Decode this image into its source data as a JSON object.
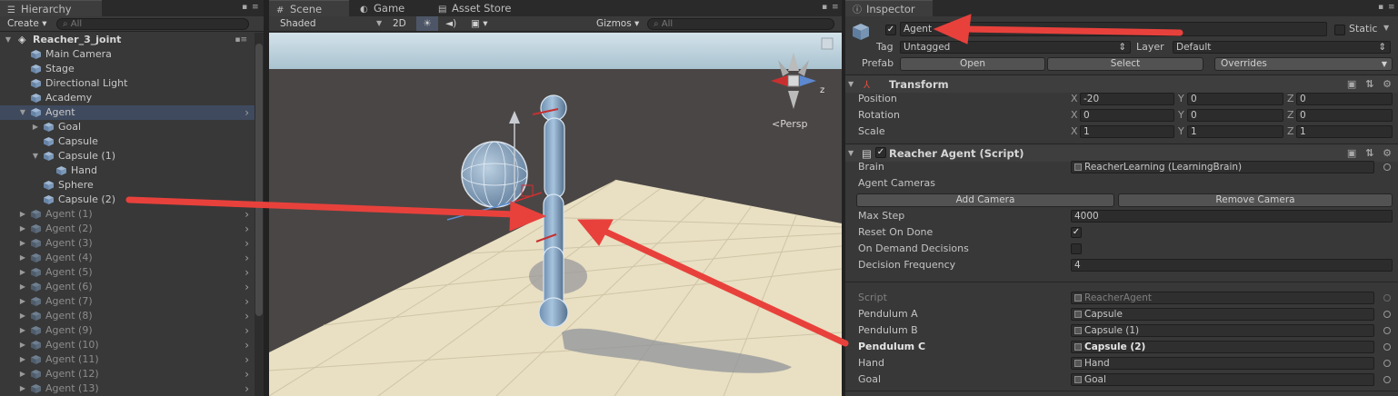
{
  "hierarchy": {
    "tab_label": "Hierarchy",
    "create_label": "Create ▾",
    "search_placeholder": "All",
    "scene_name": "Reacher_3_joint",
    "items": [
      "Main Camera",
      "Stage",
      "Directional Light",
      "Academy",
      "Agent",
      "Goal",
      "Capsule",
      "Capsule (1)",
      "Hand",
      "Sphere",
      "Capsule (2)",
      "Agent (1)",
      "Agent (2)",
      "Agent (3)",
      "Agent (4)",
      "Agent (5)",
      "Agent (6)",
      "Agent (7)",
      "Agent (8)",
      "Agent (9)",
      "Agent (10)",
      "Agent (11)",
      "Agent (12)",
      "Agent (13)"
    ]
  },
  "scene": {
    "tabs": [
      "Scene",
      "Game",
      "Asset Store"
    ],
    "shading_mode": "Shaded",
    "mode_2d": "2D",
    "gizmos_label": "Gizmos",
    "search_placeholder": "All",
    "projection_label": "Persp",
    "gizmo_axis_z": "z"
  },
  "inspector": {
    "tab_label": "Inspector",
    "object_name": "Agent",
    "static_label": "Static",
    "tag_label": "Tag",
    "tag_value": "Untagged",
    "layer_label": "Layer",
    "layer_value": "Default",
    "prefab_label": "Prefab",
    "open_label": "Open",
    "select_label": "Select",
    "overrides_label": "Overrides",
    "transform": {
      "title": "Transform",
      "rows": [
        {
          "label": "Position",
          "x": "-20",
          "y": "0",
          "z": "0"
        },
        {
          "label": "Rotation",
          "x": "0",
          "y": "0",
          "z": "0"
        },
        {
          "label": "Scale",
          "x": "1",
          "y": "1",
          "z": "1"
        }
      ]
    },
    "script": {
      "title": "Reacher Agent (Script)",
      "brain_label": "Brain",
      "brain_value": "ReacherLearning (LearningBrain)",
      "agent_cameras_label": "Agent Cameras",
      "add_camera": "Add Camera",
      "remove_camera": "Remove Camera",
      "max_step_label": "Max Step",
      "max_step_value": "4000",
      "reset_on_done_label": "Reset On Done",
      "on_demand_label": "On Demand Decisions",
      "decision_freq_label": "Decision Frequency",
      "decision_freq_value": "4",
      "script_label": "Script",
      "script_value": "ReacherAgent",
      "pendulum_a_label": "Pendulum A",
      "pendulum_a_value": "Capsule",
      "pendulum_b_label": "Pendulum B",
      "pendulum_b_value": "Capsule (1)",
      "pendulum_c_label": "Pendulum C",
      "pendulum_c_value": "Capsule (2)",
      "hand_label": "Hand",
      "hand_value": "Hand",
      "goal_label": "Goal",
      "goal_value": "Goal"
    }
  },
  "colors": {
    "annotation_arrow": "#e8413c",
    "selection": "#3f4a5e",
    "sky": "#bfd2dd",
    "floor": "#e9dfc2"
  }
}
